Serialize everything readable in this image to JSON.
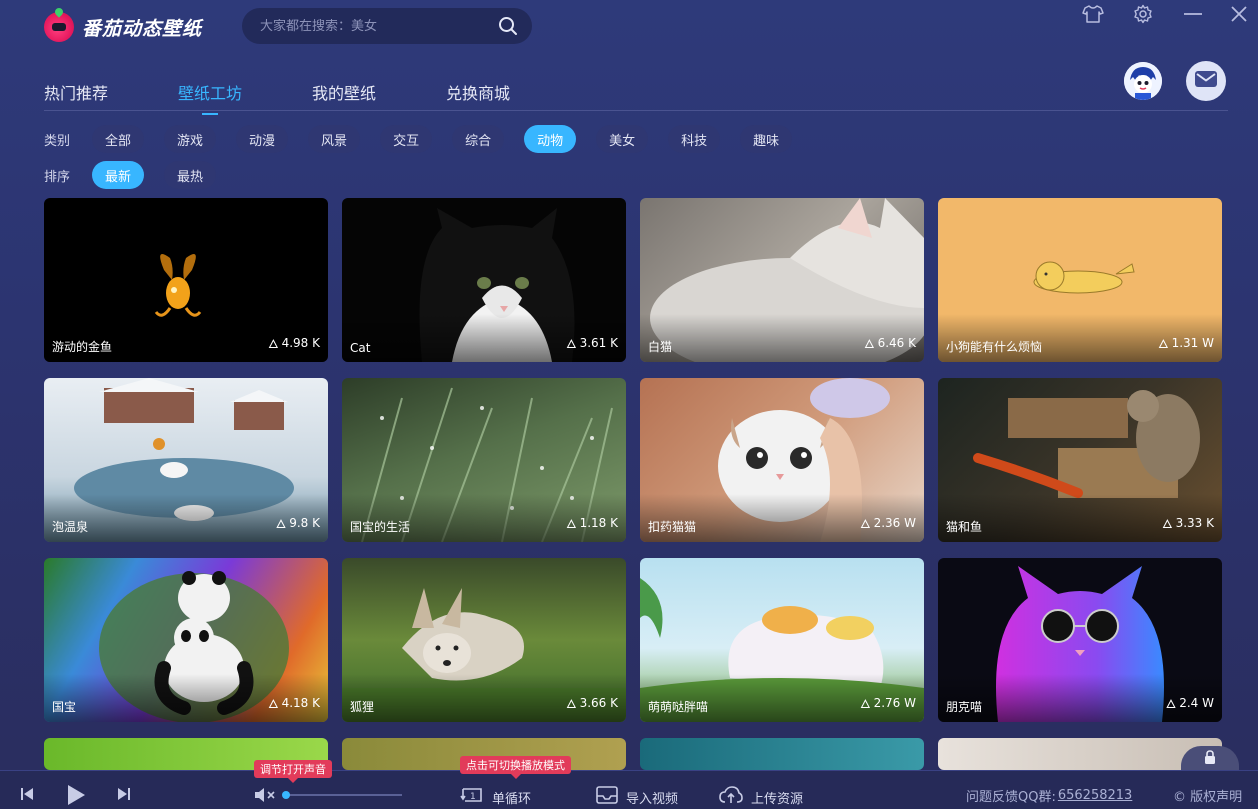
{
  "app": {
    "name": "番茄动态壁纸"
  },
  "search": {
    "placeholder": "大家都在搜索：美女"
  },
  "tabs": [
    {
      "label": "热门推荐"
    },
    {
      "label": "壁纸工坊",
      "active": true
    },
    {
      "label": "我的壁纸"
    },
    {
      "label": "兑换商城"
    }
  ],
  "filters": {
    "category_label": "类别",
    "categories": [
      "全部",
      "游戏",
      "动漫",
      "风景",
      "交互",
      "综合",
      "动物",
      "美女",
      "科技",
      "趣味"
    ],
    "category_selected": "动物",
    "sort_label": "排序",
    "sorts": [
      "最新",
      "最热"
    ],
    "sort_selected": "最新"
  },
  "wallpapers": [
    {
      "title": "游动的金鱼",
      "heat": "4.98 K"
    },
    {
      "title": "Cat",
      "heat": "3.61 K"
    },
    {
      "title": "白猫",
      "heat": "6.46 K"
    },
    {
      "title": "小狗能有什么烦恼",
      "heat": "1.31 W"
    },
    {
      "title": "泡温泉",
      "heat": "9.8 K"
    },
    {
      "title": "国宝的生活",
      "heat": "1.18 K"
    },
    {
      "title": "扣药猫猫",
      "heat": "2.36 W"
    },
    {
      "title": "猫和鱼",
      "heat": "3.33 K"
    },
    {
      "title": "国宝",
      "heat": "4.18 K"
    },
    {
      "title": "狐狸",
      "heat": "3.66 K"
    },
    {
      "title": "萌萌哒胖喵",
      "heat": "2.76 W"
    },
    {
      "title": "朋克喵",
      "heat": "2.4 W"
    }
  ],
  "player": {
    "volume_tooltip": "调节打开声音",
    "mode_tooltip": "点击可切换播放模式",
    "mode_label": "单循环",
    "import_label": "导入视频",
    "upload_label": "上传资源",
    "feedback_label": "问题反馈QQ群:",
    "qq_group": "656258213",
    "copyright_label": "© 版权声明"
  },
  "colors": {
    "accent": "#38b6ff",
    "background": "#2c3470",
    "tooltip": "#e23b5a"
  }
}
